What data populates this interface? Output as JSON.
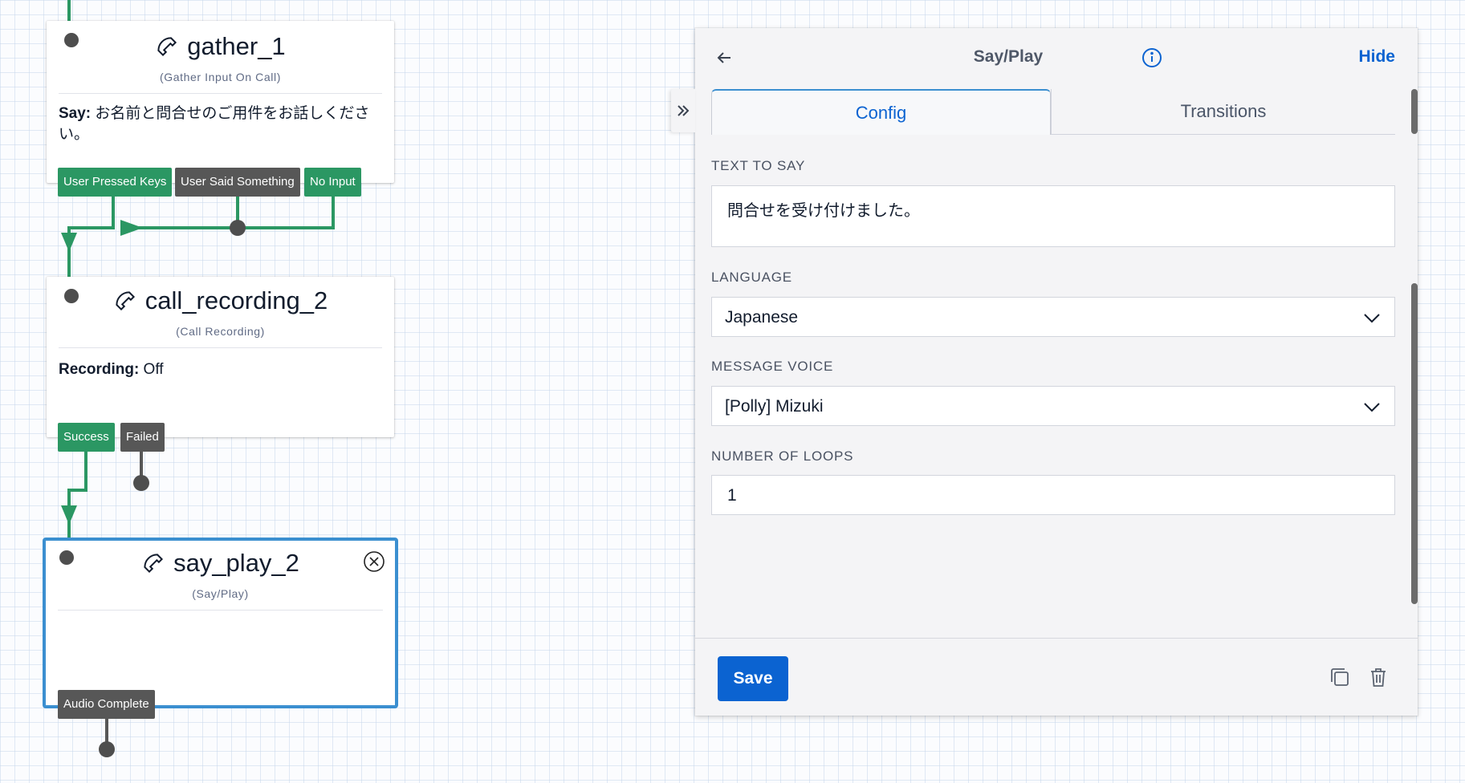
{
  "canvas": {
    "widgets": [
      {
        "name": "gather_1",
        "type_label": "(Gather Input On Call)",
        "body_label": "Say:",
        "body_value": " お名前と問合せのご用件をお話しください。",
        "transitions": [
          "User Pressed Keys",
          "User Said Something",
          "No Input"
        ]
      },
      {
        "name": "call_recording_2",
        "type_label": "(Call Recording)",
        "body_label": "Recording:",
        "body_value": " Off",
        "transitions": [
          "Success",
          "Failed"
        ]
      },
      {
        "name": "say_play_2",
        "type_label": "(Say/Play)",
        "transitions": [
          "Audio Complete"
        ]
      }
    ]
  },
  "panel": {
    "title": "Say/Play",
    "hide_label": "Hide",
    "tabs": [
      "Config",
      "Transitions"
    ],
    "active_tab": "Config",
    "fields": {
      "text_to_say": {
        "label": "TEXT TO SAY",
        "value": "問合せを受け付けました。"
      },
      "language": {
        "label": "LANGUAGE",
        "value": "Japanese"
      },
      "message_voice": {
        "label": "MESSAGE VOICE",
        "value": "[Polly] Mizuki"
      },
      "number_of_loops": {
        "label": "NUMBER OF LOOPS",
        "value": "1"
      }
    },
    "save_label": "Save"
  },
  "colors": {
    "accent_blue": "#0b63d1",
    "selected_border": "#3b8fd0",
    "transition_green": "#2b9763",
    "transition_gray": "#575757",
    "wire_green": "#2b9763"
  },
  "icons": [
    "phone-handset-icon",
    "close-circle-icon",
    "back-arrow-icon",
    "info-icon",
    "double-chevron-right-icon",
    "chevron-down-icon",
    "copy-icon",
    "trash-icon"
  ]
}
